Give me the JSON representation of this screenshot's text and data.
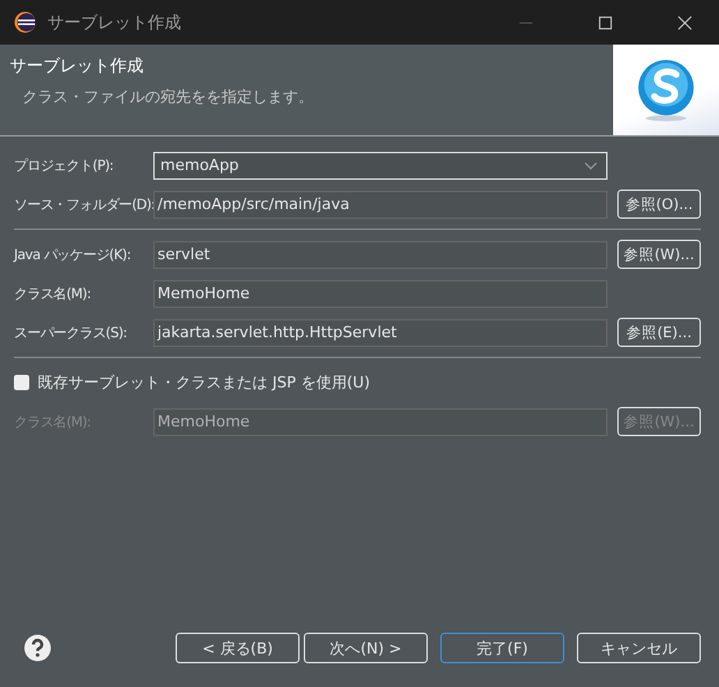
{
  "window": {
    "title": "サーブレット作成"
  },
  "header": {
    "title": "サーブレット作成",
    "description": "クラス・ファイルの宛先をを指定します。"
  },
  "groups": [
    {
      "rows": [
        {
          "kind": "combo",
          "label": "プロジェクト(P):",
          "value": "memoApp",
          "disabled": false
        },
        {
          "kind": "text",
          "label": "ソース・フォルダー(D):",
          "value": "/memoApp/src/main/java",
          "disabled": false,
          "button": "参照(O)..."
        }
      ]
    },
    {
      "rows": [
        {
          "kind": "text",
          "label": "Java パッケージ(K):",
          "value": "servlet",
          "disabled": false,
          "button": "参照(W)..."
        },
        {
          "kind": "text",
          "label": "クラス名(M):",
          "value": "MemoHome",
          "disabled": false
        },
        {
          "kind": "text",
          "label": "スーパークラス(S):",
          "value": "jakarta.servlet.http.HttpServlet",
          "disabled": false,
          "button": "参照(E)..."
        }
      ]
    },
    {
      "rows": [
        {
          "kind": "checkbox",
          "label": "既存サーブレット・クラスまたは JSP を使用(U)",
          "checked": false
        },
        {
          "kind": "text",
          "label": "クラス名(M):",
          "value": "MemoHome",
          "disabled": true,
          "button": "参照(W)..."
        }
      ]
    }
  ],
  "buttons": [
    {
      "label": "< 戻る(B)",
      "default": false
    },
    {
      "label": "次へ(N) >",
      "default": false
    },
    {
      "label": "完了(F)",
      "default": true
    },
    {
      "label": "キャンセル",
      "default": false
    }
  ]
}
